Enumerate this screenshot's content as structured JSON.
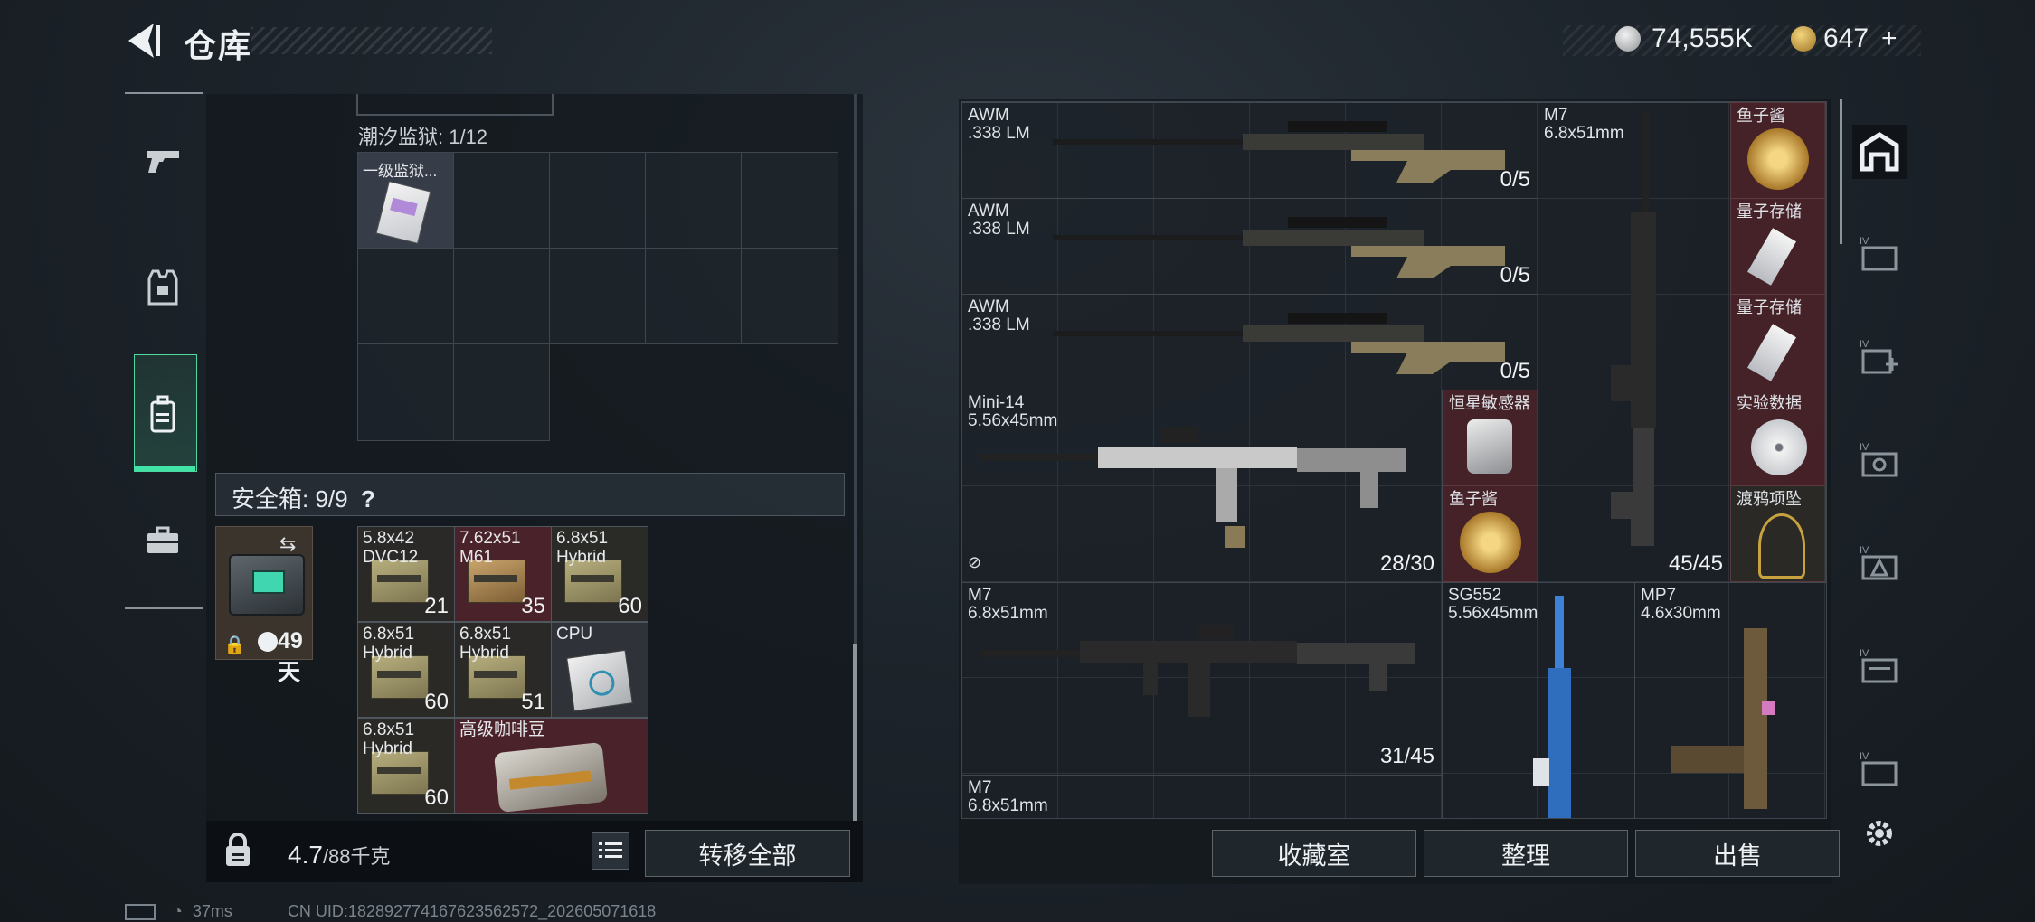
{
  "header": {
    "title": "仓库"
  },
  "currency": {
    "silver": "74,555K",
    "gold": "647",
    "gold_plus": "+"
  },
  "nav": [
    "pistol-icon",
    "armor-icon",
    "backpack-icon",
    "briefcase-icon"
  ],
  "prison": {
    "label": "潮汐监狱: 1/12",
    "card_name": "一级监狱..."
  },
  "safe": {
    "label": "安全箱: 9/9",
    "help": "?",
    "days": "49天"
  },
  "safe_items": [
    {
      "name1": "5.8x42",
      "name2": "DVC12",
      "count": "21"
    },
    {
      "name1": "7.62x51",
      "name2": "M61",
      "count": "35"
    },
    {
      "name1": "6.8x51",
      "name2": "Hybrid",
      "count": "60"
    },
    {
      "name1": "6.8x51",
      "name2": "Hybrid",
      "count": "60"
    },
    {
      "name1": "6.8x51",
      "name2": "Hybrid",
      "count": "51"
    },
    {
      "name1": "CPU",
      "name2": "",
      "count": ""
    },
    {
      "name1": "6.8x51",
      "name2": "Hybrid",
      "count": "60"
    },
    {
      "name1": "高级咖啡豆",
      "name2": "",
      "count": ""
    }
  ],
  "weight": {
    "value": "4.7",
    "unit": "/88千克"
  },
  "buttons": {
    "transfer_all": "转移全部",
    "collection": "收藏室",
    "organize": "整理",
    "sell": "出售"
  },
  "weapons": [
    {
      "name": "AWM",
      "cal": ".338 LM",
      "count": "0/5"
    },
    {
      "name": "AWM",
      "cal": ".338 LM",
      "count": "0/5"
    },
    {
      "name": "AWM",
      "cal": ".338 LM",
      "count": "0/5"
    },
    {
      "name": "Mini-14",
      "cal": "5.56x45mm",
      "count": "28/30"
    },
    {
      "name": "M7",
      "cal": "6.8x51mm",
      "count": "31/45"
    },
    {
      "name": "M7",
      "cal": "6.8x51mm",
      "count": "45/45"
    },
    {
      "name": "SG552",
      "cal": "5.56x45mm",
      "count": ""
    },
    {
      "name": "MP7",
      "cal": "4.6x30mm",
      "count": ""
    },
    {
      "name": "M7",
      "cal": "6.8x51mm",
      "count": ""
    }
  ],
  "loot": [
    {
      "name": "鱼子酱"
    },
    {
      "name": "量子存储"
    },
    {
      "name": "量子存储"
    },
    {
      "name": "恒星敏感器"
    },
    {
      "name": "实验数据"
    },
    {
      "name": "鱼子酱"
    },
    {
      "name": "渡鸦项坠"
    }
  ],
  "status": {
    "ping": "37ms",
    "uid": "CN UID:1828927741676235625​72_202605071618"
  },
  "colors": {
    "accent": "#42e3a6",
    "loot_bg": "#6e2830"
  }
}
